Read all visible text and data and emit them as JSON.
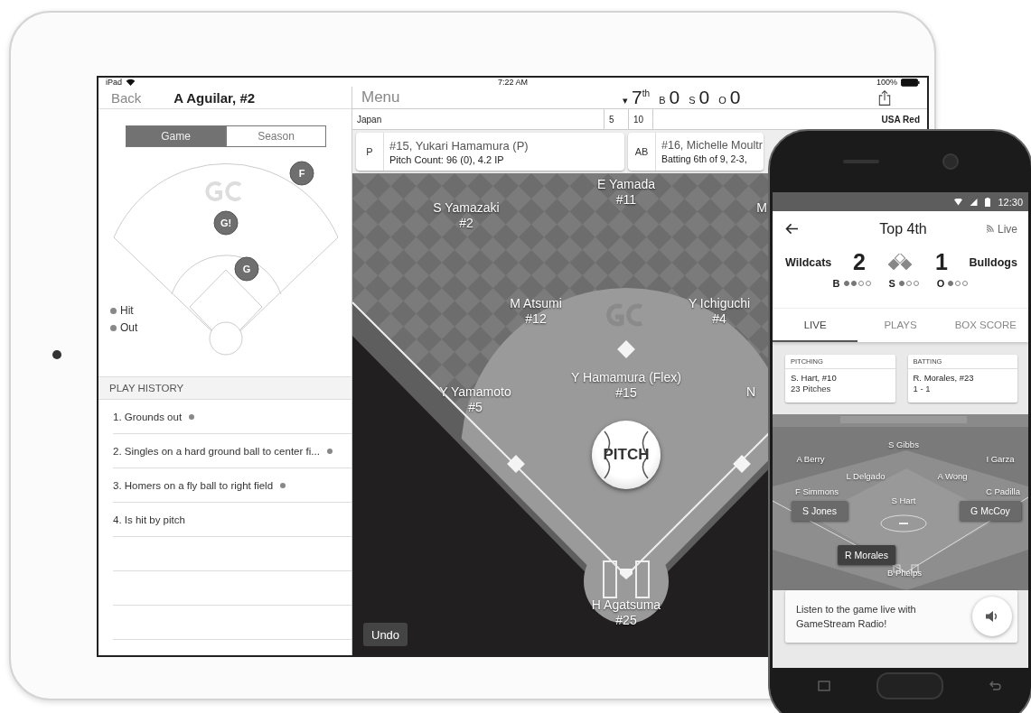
{
  "ipad": {
    "status_bar": {
      "device": "iPad",
      "time": "7:22 AM",
      "battery": "100%"
    },
    "player_panel": {
      "back": "Back",
      "title": "A Aguilar, #2",
      "segments": [
        {
          "label": "Game",
          "selected": true
        },
        {
          "label": "Season",
          "selected": false
        }
      ],
      "spray_chart": {
        "markers": [
          {
            "label": "F"
          },
          {
            "label": "G!"
          },
          {
            "label": "G"
          }
        ],
        "legend": [
          "Hit",
          "Out"
        ]
      },
      "play_history": {
        "title": "PLAY HISTORY",
        "items": [
          {
            "text": "1. Grounds out",
            "marked": true
          },
          {
            "text": "2. Singles on a hard ground ball to center fi...",
            "marked": true
          },
          {
            "text": "3. Homers on a fly ball to right field",
            "marked": true
          },
          {
            "text": "4. Is hit by pitch",
            "marked": false
          }
        ]
      }
    },
    "game": {
      "menu": "Menu",
      "inning_marker": "▾",
      "inning": "7$^{th}$",
      "counts": [
        {
          "label": "B",
          "value": "0"
        },
        {
          "label": "S",
          "value": "0"
        },
        {
          "label": "O",
          "value": "0"
        }
      ],
      "linescore": {
        "away": "Japan",
        "column_2": "5",
        "column_3": "10",
        "home": "USA Red"
      },
      "cards": [
        {
          "tag": "P",
          "line_1": "#15, Yukari Hamamura (P)",
          "line_2": "Pitch Count: 96 (0), 4.2 IP"
        },
        {
          "tag": "AB",
          "line_1": "#16, Michelle Moultr",
          "line_2": "Batting 6th of 9, 2-3,"
        }
      ],
      "players": [
        {
          "name": "S Yamazaki",
          "number": "#2"
        },
        {
          "name": "E Yamada",
          "number": "#11"
        },
        {
          "name": "M"
        },
        {
          "name": "M Atsumi",
          "number": "#12"
        },
        {
          "name": "Y Ichiguchi",
          "number": "#4"
        },
        {
          "name": "Y Yamamoto",
          "number": "#5"
        },
        {
          "name": "Y Hamamura (Flex)",
          "number": "#15"
        },
        {
          "name": "N"
        },
        {
          "name": "H Agatsuma",
          "number": "#25"
        }
      ],
      "pitch": "PITCH",
      "undo": "Undo"
    }
  },
  "phone": {
    "status_time": "12:30",
    "title": "Top 4th",
    "live": "Live",
    "away": {
      "name": "Wildcats",
      "score": "2"
    },
    "home": {
      "name": "Bulldogs",
      "score": "1"
    },
    "bases": {
      "first": true,
      "second": false,
      "third": true
    },
    "count": [
      {
        "label": "B",
        "dots": [
          true,
          true,
          false,
          false
        ]
      },
      {
        "label": "S",
        "dots": [
          true,
          false,
          false
        ]
      },
      {
        "label": "O",
        "dots": [
          true,
          false,
          false
        ]
      }
    ],
    "tabs": [
      {
        "label": "LIVE",
        "selected": true
      },
      {
        "label": "PLAYS",
        "selected": false
      },
      {
        "label": "BOX SCORE",
        "selected": false
      }
    ],
    "cards": [
      {
        "title": "PITCHING",
        "name": "S. Hart, #10",
        "detail": "23 Pitches"
      },
      {
        "title": "BATTING",
        "name": "R. Morales, #23",
        "detail": "1 - 1"
      }
    ],
    "players": [
      {
        "name": "S Gibbs",
        "kind": "plain"
      },
      {
        "name": "A Berry",
        "kind": "plain"
      },
      {
        "name": "I Garza",
        "kind": "plain"
      },
      {
        "name": "L Delgado",
        "kind": "plain"
      },
      {
        "name": "A Wong",
        "kind": "plain"
      },
      {
        "name": "F Simmons",
        "kind": "plain"
      },
      {
        "name": "C Padilla",
        "kind": "plain"
      },
      {
        "name": "S Hart",
        "kind": "plain"
      },
      {
        "name": "S Jones",
        "kind": "chip"
      },
      {
        "name": "G McCoy",
        "kind": "chip"
      },
      {
        "name": "R Morales",
        "kind": "batter"
      },
      {
        "name": "B Phelps",
        "kind": "plain"
      }
    ],
    "radio": "Listen to the game live with GameStream Radio!"
  }
}
